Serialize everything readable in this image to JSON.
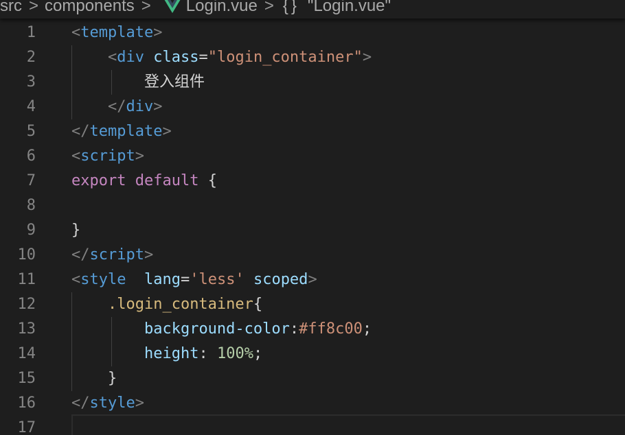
{
  "breadcrumb": {
    "items": [
      {
        "label": "src"
      },
      {
        "label": "components"
      },
      {
        "label": "Login.vue",
        "icon": "vue-icon"
      },
      {
        "label": "\"Login.vue\"",
        "icon": "braces-icon"
      }
    ],
    "separator": ">",
    "braces": "{}"
  },
  "colors": {
    "background": "#1e1e1e",
    "line_number": "#858585",
    "tag": "#569cd6",
    "attribute": "#9cdcfe",
    "string": "#ce9178",
    "keyword": "#c586c0",
    "selector": "#d7ba7d",
    "number": "#b5cea8",
    "vue_green": "#41b883"
  },
  "code": {
    "lines": [
      {
        "number": "1",
        "tokens": [
          [
            "<",
            "punct"
          ],
          [
            "template",
            "tag"
          ],
          [
            ">",
            "punct"
          ]
        ]
      },
      {
        "number": "2",
        "tokens": [
          [
            "    ",
            "plain"
          ],
          [
            "<",
            "punct"
          ],
          [
            "div",
            "tag"
          ],
          [
            " ",
            "plain"
          ],
          [
            "class",
            "attr"
          ],
          [
            "=",
            "plain"
          ],
          [
            "\"login_container\"",
            "str"
          ],
          [
            ">",
            "punct"
          ]
        ]
      },
      {
        "number": "3",
        "tokens": [
          [
            "        ",
            "plain"
          ],
          [
            "登入组件",
            "cn"
          ]
        ]
      },
      {
        "number": "4",
        "tokens": [
          [
            "    ",
            "plain"
          ],
          [
            "</",
            "punct"
          ],
          [
            "div",
            "tag"
          ],
          [
            ">",
            "punct"
          ]
        ]
      },
      {
        "number": "5",
        "tokens": [
          [
            "</",
            "punct"
          ],
          [
            "template",
            "tag"
          ],
          [
            ">",
            "punct"
          ]
        ]
      },
      {
        "number": "6",
        "tokens": [
          [
            "<",
            "punct"
          ],
          [
            "script",
            "tag"
          ],
          [
            ">",
            "punct"
          ]
        ]
      },
      {
        "number": "7",
        "tokens": [
          [
            "export",
            "kw"
          ],
          [
            " ",
            "plain"
          ],
          [
            "default",
            "kw"
          ],
          [
            " {",
            "plain"
          ]
        ]
      },
      {
        "number": "8",
        "tokens": []
      },
      {
        "number": "9",
        "tokens": [
          [
            "}",
            "plain"
          ]
        ]
      },
      {
        "number": "10",
        "tokens": [
          [
            "</",
            "punct"
          ],
          [
            "script",
            "tag"
          ],
          [
            ">",
            "punct"
          ]
        ]
      },
      {
        "number": "11",
        "tokens": [
          [
            "<",
            "punct"
          ],
          [
            "style",
            "tag"
          ],
          [
            "  ",
            "plain"
          ],
          [
            "lang",
            "attr"
          ],
          [
            "=",
            "plain"
          ],
          [
            "'less'",
            "str"
          ],
          [
            " ",
            "plain"
          ],
          [
            "scoped",
            "attr"
          ],
          [
            ">",
            "punct"
          ]
        ]
      },
      {
        "number": "12",
        "tokens": [
          [
            "    ",
            "plain"
          ],
          [
            ".login_container",
            "sel"
          ],
          [
            "{",
            "plain"
          ]
        ]
      },
      {
        "number": "13",
        "tokens": [
          [
            "        ",
            "plain"
          ],
          [
            "background-color",
            "attr"
          ],
          [
            ":",
            "plain"
          ],
          [
            "#ff8c00",
            "str"
          ],
          [
            ";",
            "plain"
          ]
        ]
      },
      {
        "number": "14",
        "tokens": [
          [
            "        ",
            "plain"
          ],
          [
            "height",
            "attr"
          ],
          [
            ": ",
            "plain"
          ],
          [
            "100%",
            "num"
          ],
          [
            ";",
            "plain"
          ]
        ]
      },
      {
        "number": "15",
        "tokens": [
          [
            "    ",
            "plain"
          ],
          [
            "}",
            "plain"
          ]
        ]
      },
      {
        "number": "16",
        "tokens": [
          [
            "</",
            "punct"
          ],
          [
            "style",
            "tag"
          ],
          [
            ">",
            "punct"
          ]
        ]
      },
      {
        "number": "17",
        "tokens": []
      }
    ]
  }
}
